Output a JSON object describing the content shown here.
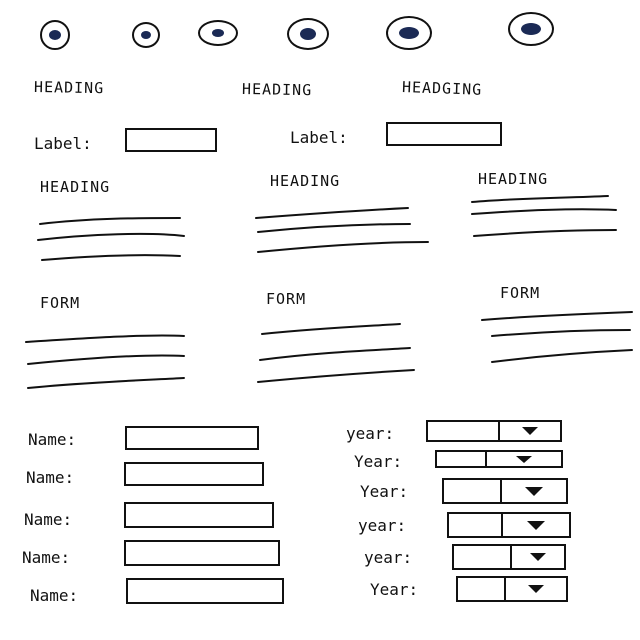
{
  "top_radios": [
    {
      "selected": true
    },
    {
      "selected": true
    },
    {
      "selected": true
    },
    {
      "selected": true
    },
    {
      "selected": true
    },
    {
      "selected": true
    }
  ],
  "top_headings": [
    "HEADING",
    "HEADING",
    "HEADGING"
  ],
  "label_row": [
    "Label:",
    "Label:"
  ],
  "sections": [
    {
      "heading": "HEADING"
    },
    {
      "heading": "HEADING"
    },
    {
      "heading": "HEADING"
    }
  ],
  "forms": [
    {
      "heading": "FORM"
    },
    {
      "heading": "FORM"
    },
    {
      "heading": "FORM"
    }
  ],
  "name_fields": [
    {
      "label": "Name:"
    },
    {
      "label": "Name:"
    },
    {
      "label": "Name:"
    },
    {
      "label": "Name:"
    },
    {
      "label": "Name:"
    }
  ],
  "year_fields": [
    {
      "label": "year:"
    },
    {
      "label": "Year:"
    },
    {
      "label": "Year:"
    },
    {
      "label": "year:"
    },
    {
      "label": "year:"
    },
    {
      "label": "Year:"
    }
  ],
  "icons": {
    "dropdown": "chevron-down-icon",
    "radio": "radio-icon"
  },
  "colors": {
    "ink": "#111111",
    "radio_fill": "#1b2a55"
  }
}
